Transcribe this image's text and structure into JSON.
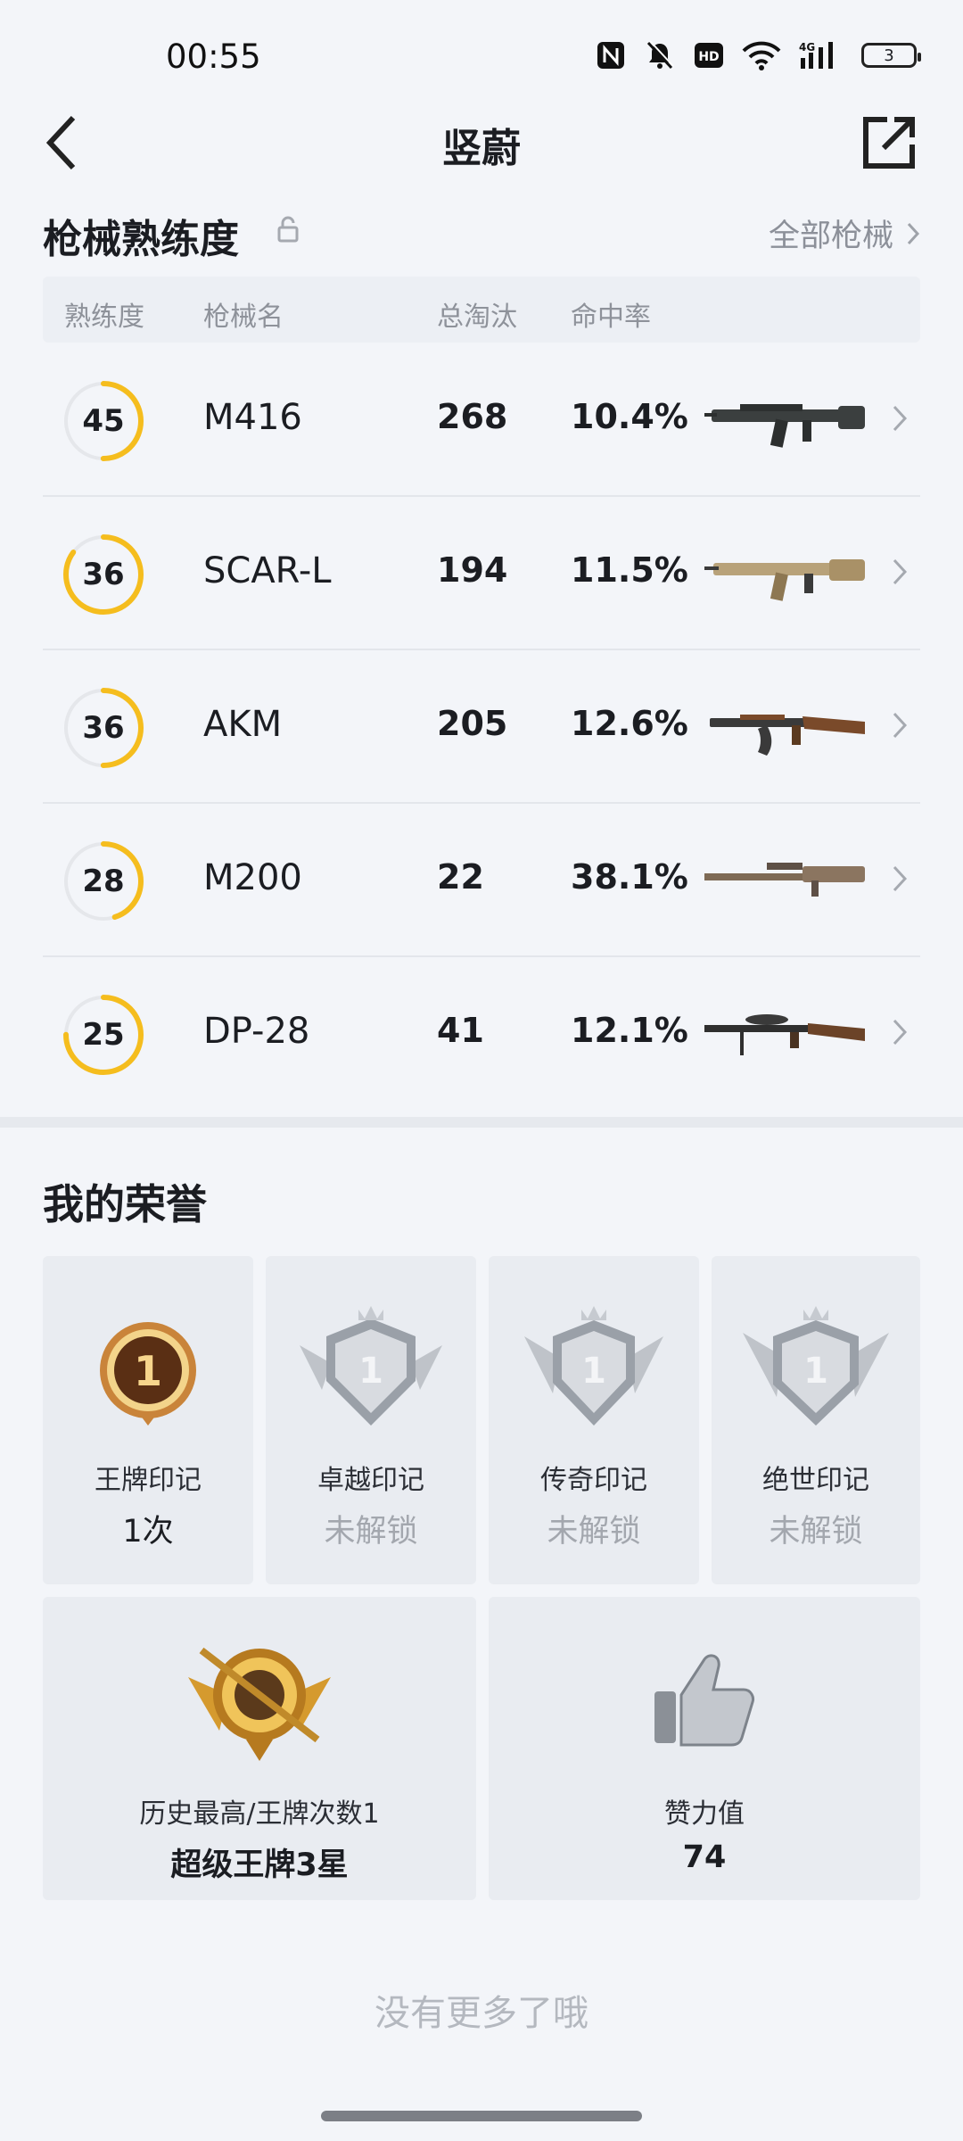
{
  "status": {
    "time": "00:55",
    "battery": "3"
  },
  "nav": {
    "title": "竖蔚"
  },
  "weapons": {
    "title": "枪械熟练度",
    "all_link": "全部枪械",
    "headers": {
      "level": "熟练度",
      "name": "枪械名",
      "kills": "总淘汰",
      "accuracy": "命中率"
    },
    "rows": [
      {
        "level": "45",
        "progress": 0.5,
        "name": "M416",
        "kills": "268",
        "accuracy": "10.4%",
        "gun_icon": "m416-rifle"
      },
      {
        "level": "36",
        "progress": 0.85,
        "name": "SCAR-L",
        "kills": "194",
        "accuracy": "11.5%",
        "gun_icon": "scar-l-rifle"
      },
      {
        "level": "36",
        "progress": 0.5,
        "name": "AKM",
        "kills": "205",
        "accuracy": "12.6%",
        "gun_icon": "akm-rifle"
      },
      {
        "level": "28",
        "progress": 0.45,
        "name": "M200",
        "kills": "22",
        "accuracy": "38.1%",
        "gun_icon": "m200-sniper"
      },
      {
        "level": "25",
        "progress": 0.75,
        "name": "DP-28",
        "kills": "41",
        "accuracy": "12.1%",
        "gun_icon": "dp28-lmg"
      }
    ]
  },
  "honor": {
    "title": "我的荣誉",
    "marks": [
      {
        "label": "王牌印记",
        "value": "1次",
        "unlocked": true,
        "icon": "ace-mark-gold-medal"
      },
      {
        "label": "卓越印记",
        "value": "未解锁",
        "unlocked": false,
        "icon": "excellence-mark-medal"
      },
      {
        "label": "传奇印记",
        "value": "未解锁",
        "unlocked": false,
        "icon": "legend-mark-medal"
      },
      {
        "label": "绝世印记",
        "value": "未解锁",
        "unlocked": false,
        "icon": "peerless-mark-medal"
      }
    ],
    "best": {
      "label": "历史最高/王牌次数1",
      "value": "超级王牌3星",
      "icon": "super-ace-rank-badge"
    },
    "likes": {
      "label": "赞力值",
      "value": "74",
      "icon": "thumbs-up-icon"
    }
  },
  "footer": {
    "no_more": "没有更多了哦"
  },
  "colors": {
    "ring": "#f5bd1e",
    "ring_track": "#e5e7eb",
    "background": "#f3f5f9",
    "card": "#e9ecf1"
  }
}
